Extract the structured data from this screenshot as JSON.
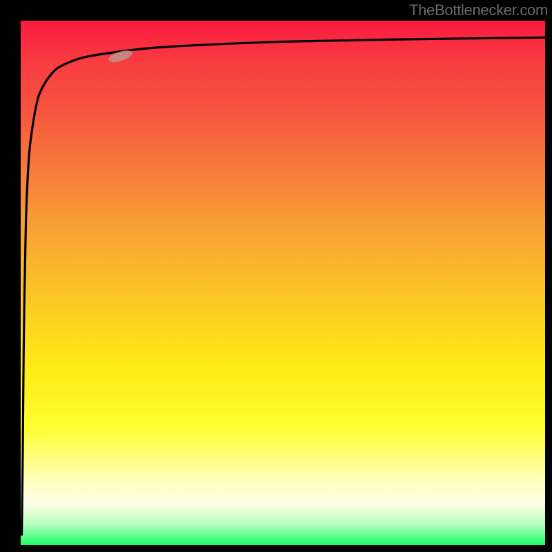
{
  "watermark": {
    "text": "TheBottlenecker.com"
  },
  "colors": {
    "curve": "#000000",
    "marker_fill": "#c88a82",
    "marker_stroke": "#c88a82",
    "axis": "#000000",
    "gradient_top": "#fa1a3f",
    "gradient_bottom": "#1aff66"
  },
  "chart_data": {
    "type": "line",
    "title": "",
    "xlabel": "",
    "ylabel": "",
    "xlim": [
      0,
      100
    ],
    "ylim": [
      0,
      100
    ],
    "grid": false,
    "legend": false,
    "series": [
      {
        "name": "curve",
        "x": [
          0.2,
          0.4,
          0.6,
          1,
          1.5,
          2,
          3,
          4,
          6,
          8,
          12,
          18,
          25,
          35,
          50,
          70,
          100
        ],
        "values": [
          2,
          18,
          40,
          62,
          73,
          78,
          84,
          87,
          90,
          91.5,
          93,
          94,
          94.8,
          95.4,
          96,
          96.4,
          96.8
        ]
      }
    ],
    "marker": {
      "cx_percent": 19,
      "cy_percent": 93.2,
      "angle_deg": -18,
      "rx_percent": 2.3,
      "ry_percent": 0.8
    }
  }
}
